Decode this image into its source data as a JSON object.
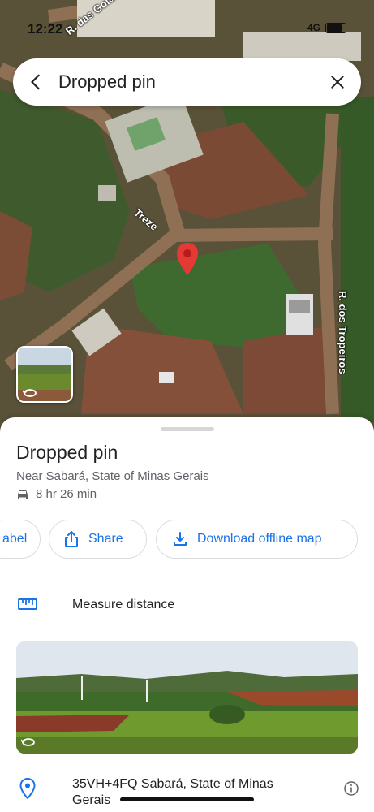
{
  "status_bar": {
    "time": "12:22",
    "network": "4G"
  },
  "search": {
    "title": "Dropped pin"
  },
  "map": {
    "street_labels": [
      "R. das Golas",
      "Treze",
      "R. dos Tropeiros"
    ]
  },
  "place": {
    "title": "Dropped pin",
    "subtitle": "Near Sabará, State of Minas Gerais",
    "drive_time": "8 hr 26 min"
  },
  "actions": {
    "label": "abel",
    "share": "Share",
    "download": "Download offline map"
  },
  "measure": {
    "label": "Measure distance"
  },
  "plus_code": {
    "text": "35VH+4FQ Sabará, State of Minas Gerais"
  },
  "colors": {
    "accent": "#1a73e8",
    "pin": "#e53935",
    "text": "#202124",
    "secondary": "#5f6368"
  },
  "icons": [
    "back-arrow-icon",
    "close-icon",
    "map-pin-icon",
    "street-view-rotate-icon",
    "car-icon",
    "share-icon",
    "download-icon",
    "ruler-icon",
    "location-pin-icon",
    "info-icon"
  ]
}
